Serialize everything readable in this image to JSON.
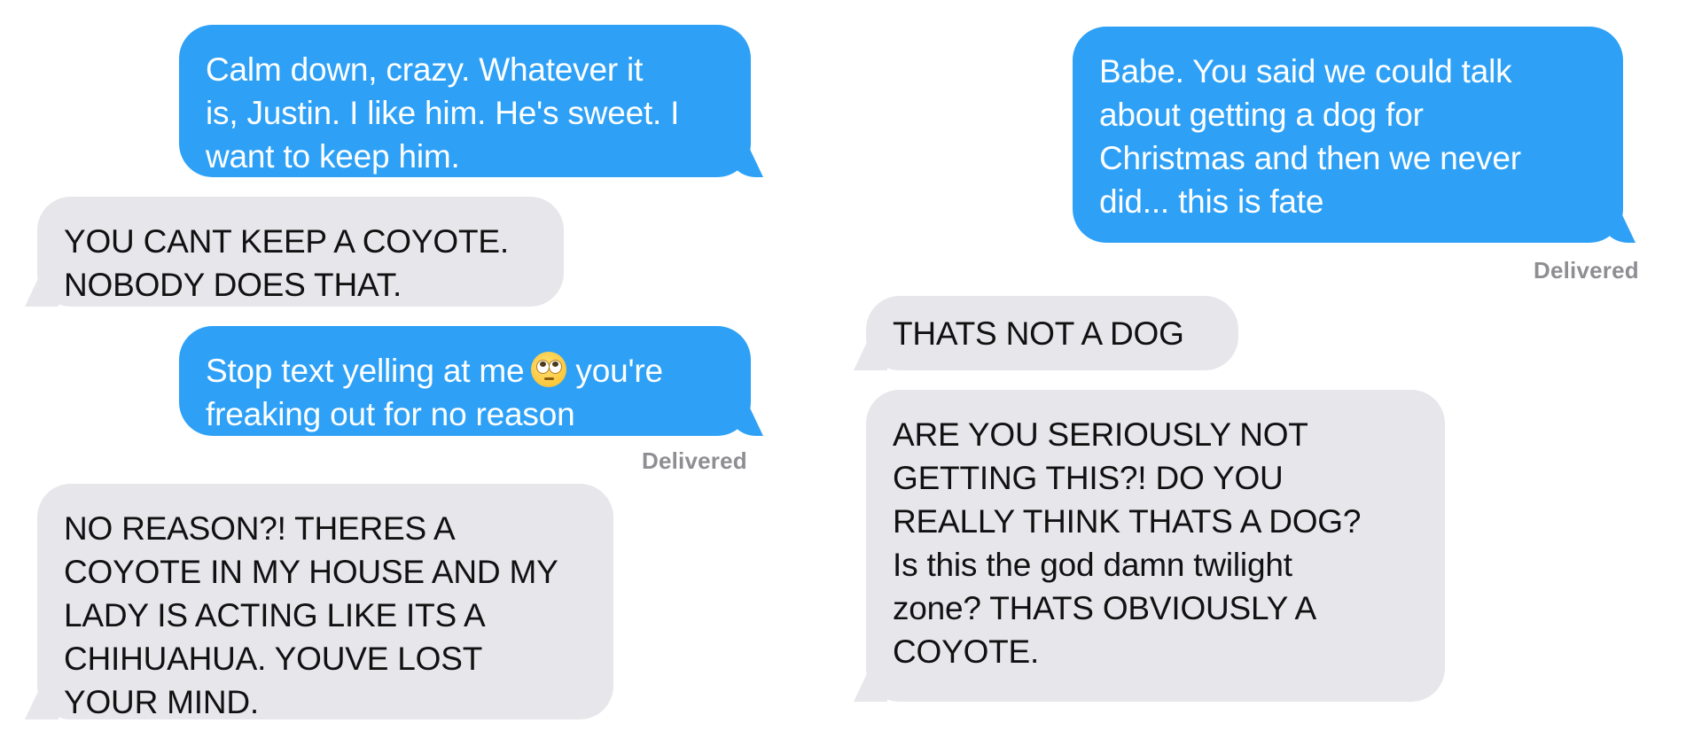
{
  "left_panel": {
    "messages": [
      {
        "type": "sent",
        "text": "Calm down, crazy. Whatever it\nis, Justin. I like him. He's sweet. I\nwant to keep him."
      },
      {
        "type": "received",
        "text": "YOU CANT KEEP A COYOTE.\nNOBODY DOES THAT."
      },
      {
        "type": "sent",
        "text_before_emoji": "Stop text yelling at me",
        "emoji": "face-with-rolling-eyes",
        "text_after_emoji": "you're",
        "text_line2": "freaking out for no reason"
      },
      {
        "type": "received",
        "text": "NO REASON?! THERES A\nCOYOTE IN MY HOUSE AND MY\nLADY IS ACTING LIKE ITS A\nCHIHUAHUA. YOUVE LOST\nYOUR MIND."
      }
    ],
    "delivered_label": "Delivered"
  },
  "right_panel": {
    "messages": [
      {
        "type": "sent",
        "text": "Babe. You said we could talk\nabout getting a dog for\nChristmas and then we never\ndid... this is fate"
      },
      {
        "type": "received",
        "text": "THATS NOT A DOG"
      },
      {
        "type": "received",
        "text": "ARE YOU SERIOUSLY NOT\nGETTING THIS?! DO YOU\nREALLY THINK THATS A DOG?\nIs this the god damn twilight\nzone? THATS OBVIOUSLY A\nCOYOTE."
      }
    ],
    "delivered_label": "Delivered"
  },
  "colors": {
    "sent_bubble": "#2ea1f7",
    "received_bubble": "#e6e6eb",
    "delivered_text": "#8e8e93"
  }
}
